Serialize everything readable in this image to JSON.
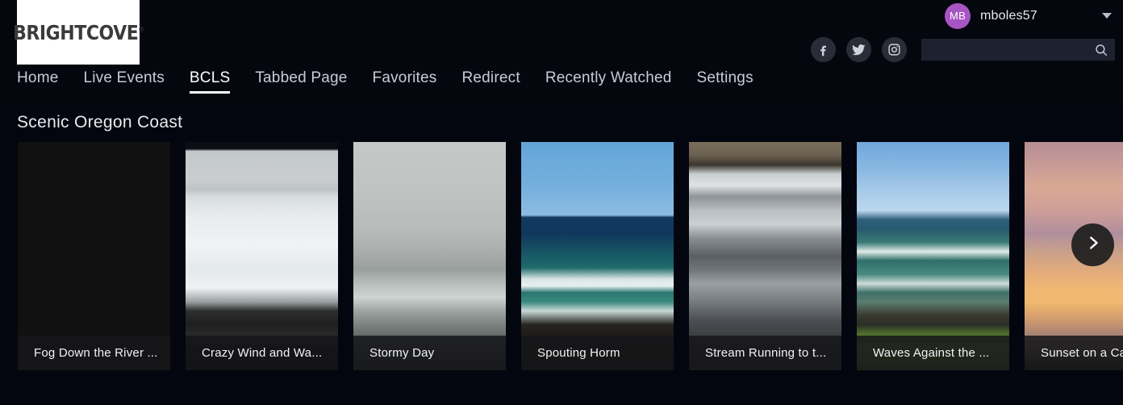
{
  "header": {
    "logo_text": "BRIGHTCOVE",
    "logo_reg": "®",
    "user": {
      "initials": "MB",
      "name": "mboles57"
    },
    "social": [
      {
        "name": "facebook-icon",
        "label": "Facebook"
      },
      {
        "name": "twitter-icon",
        "label": "Twitter"
      },
      {
        "name": "instagram-icon",
        "label": "Instagram"
      }
    ],
    "search": {
      "value": "",
      "placeholder": "",
      "icon": "search-icon"
    }
  },
  "nav": {
    "items": [
      {
        "label": "Home",
        "active": false
      },
      {
        "label": "Live Events",
        "active": false
      },
      {
        "label": "BCLS",
        "active": true
      },
      {
        "label": "Tabbed Page",
        "active": false
      },
      {
        "label": "Favorites",
        "active": false
      },
      {
        "label": "Redirect",
        "active": false
      },
      {
        "label": "Recently Watched",
        "active": false
      },
      {
        "label": "Settings",
        "active": false
      }
    ]
  },
  "shelf": {
    "title": "Scenic Oregon Coast",
    "next_icon": "chevron-right-icon",
    "cards": [
      {
        "title": "Fog Down the River ...",
        "art": "art-fog"
      },
      {
        "title": "Crazy Wind and Wa...",
        "art": "art-storm"
      },
      {
        "title": "Stormy Day",
        "art": "art-stormy"
      },
      {
        "title": "Spouting Horm",
        "art": "art-spout"
      },
      {
        "title": "Stream Running to t...",
        "art": "art-stream"
      },
      {
        "title": "Waves Against the ...",
        "art": "art-waves"
      },
      {
        "title": "Sunset on a Ca",
        "art": "art-sunset"
      }
    ]
  },
  "colors": {
    "background": "#04060f",
    "header_bg": "#05070f",
    "accent_avatar": "#a855c4",
    "nav_active": "#ffffff",
    "nav_inactive": "#c8ccd6",
    "search_bg": "#1e2230",
    "social_bg": "#2a2d38"
  }
}
